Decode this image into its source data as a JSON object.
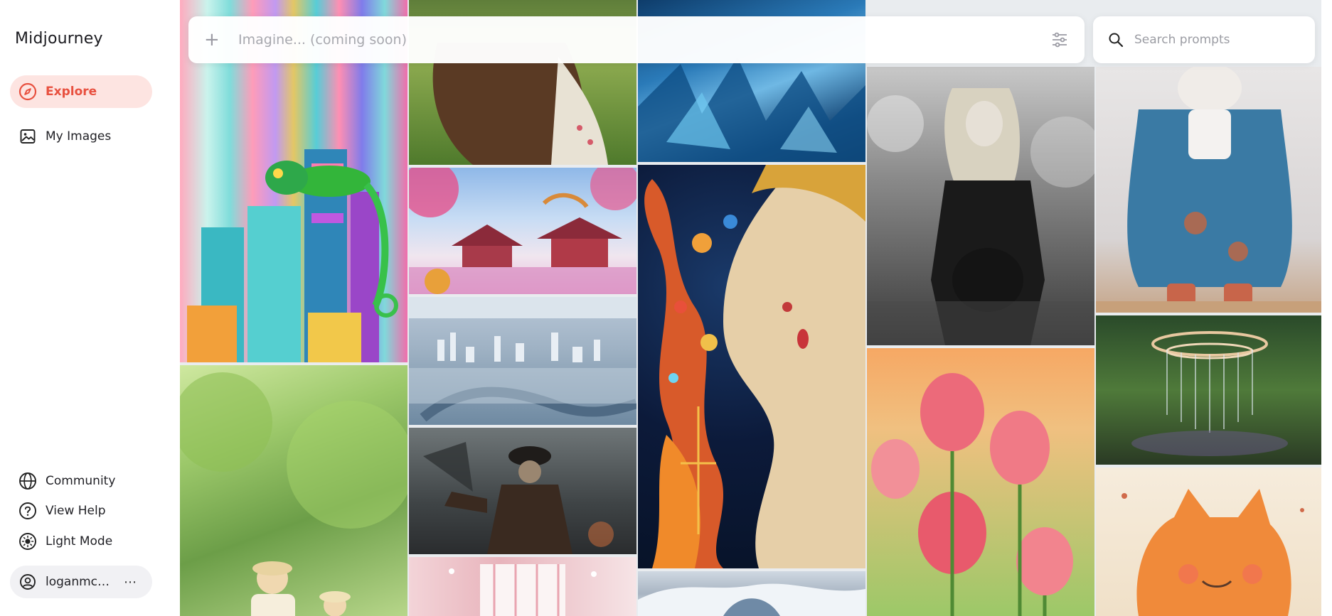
{
  "app": {
    "title": "Midjourney"
  },
  "sidebar": {
    "nav": [
      {
        "label": "Explore",
        "icon": "compass-icon",
        "active": true
      },
      {
        "label": "My Images",
        "icon": "image-icon",
        "active": false
      }
    ],
    "bottom": [
      {
        "label": "Community",
        "icon": "globe-icon"
      },
      {
        "label": "View Help",
        "icon": "help-circle-icon"
      },
      {
        "label": "Light Mode",
        "icon": "sun-icon"
      }
    ],
    "user": {
      "name": "loganmcw...",
      "more": "⋯"
    }
  },
  "topbar": {
    "plus": "+",
    "imagine_placeholder": "Imagine... (coming soon)"
  },
  "search": {
    "placeholder": "Search prompts"
  },
  "colors": {
    "accent": "#e8503f",
    "accent_bg": "#fde4e1"
  },
  "gallery": {
    "images": [
      {
        "subject": "chameleon on colorful cylinders",
        "icon": "gallery-image"
      },
      {
        "subject": "woman with curly hair in field",
        "icon": "gallery-image"
      },
      {
        "subject": "blue crystal abstract",
        "icon": "gallery-image"
      },
      {
        "subject": "black and white pregnant woman portrait",
        "icon": "gallery-image"
      },
      {
        "subject": "ceramic cat figurine in blue robe",
        "icon": "gallery-image"
      },
      {
        "subject": "asian temple with dragons",
        "icon": "gallery-image"
      },
      {
        "subject": "mosaic cosmic woman face",
        "icon": "gallery-image"
      },
      {
        "subject": "aerial futuristic city",
        "icon": "gallery-image"
      },
      {
        "subject": "pink tulips at sunset",
        "icon": "gallery-image"
      },
      {
        "subject": "forest ring light installation",
        "icon": "gallery-image"
      },
      {
        "subject": "pirate warrior",
        "icon": "gallery-image"
      },
      {
        "subject": "woman and child in green forest",
        "icon": "gallery-image"
      },
      {
        "subject": "pink room with curtains",
        "icon": "gallery-image"
      },
      {
        "subject": "snowy mountain sky",
        "icon": "gallery-image"
      },
      {
        "subject": "orange cat illustration",
        "icon": "gallery-image"
      }
    ]
  }
}
